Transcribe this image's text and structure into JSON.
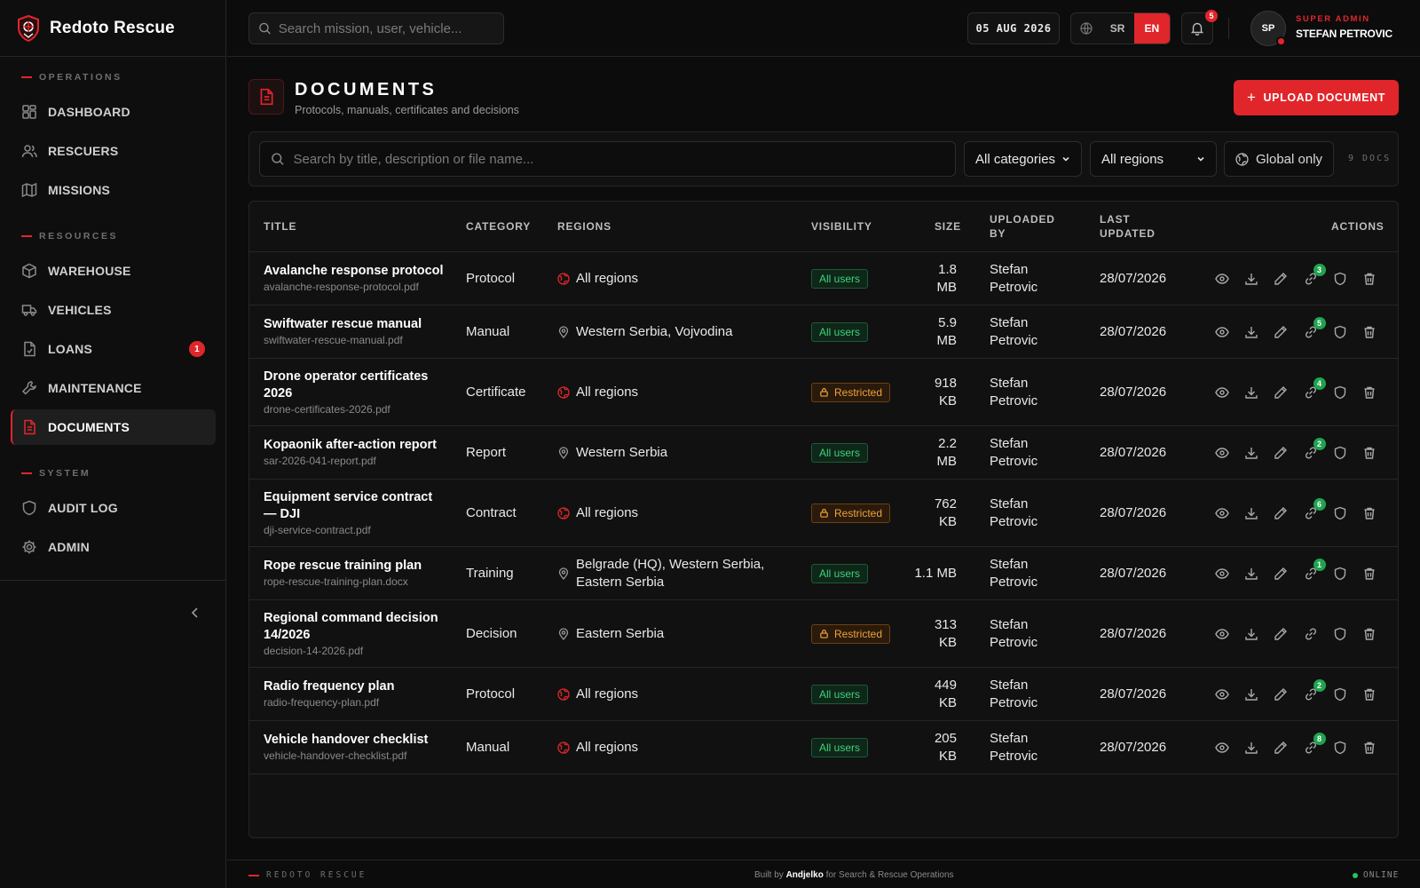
{
  "brand": {
    "name": "Redoto Rescue"
  },
  "sidebar": {
    "sections": [
      {
        "label": "OPERATIONS"
      },
      {
        "label": "RESOURCES"
      },
      {
        "label": "SYSTEM"
      }
    ],
    "items": [
      {
        "label": "DASHBOARD",
        "icon": "dashboard-icon"
      },
      {
        "label": "RESCUERS",
        "icon": "users-icon"
      },
      {
        "label": "MISSIONS",
        "icon": "map-icon"
      },
      {
        "label": "WAREHOUSE",
        "icon": "box-icon"
      },
      {
        "label": "VEHICLES",
        "icon": "truck-icon"
      },
      {
        "label": "LOANS",
        "icon": "file-icon",
        "badge": "1"
      },
      {
        "label": "MAINTENANCE",
        "icon": "wrench-icon"
      },
      {
        "label": "DOCUMENTS",
        "icon": "document-icon",
        "active": true
      },
      {
        "label": "AUDIT LOG",
        "icon": "shield-icon"
      },
      {
        "label": "ADMIN",
        "icon": "gear-icon"
      }
    ]
  },
  "topbar": {
    "search_placeholder": "Search mission, user, vehicle...",
    "date": "05 AUG 2026",
    "lang_sr": "SR",
    "lang_en": "EN",
    "notifications_count": "5",
    "avatar_initials": "SP",
    "user_role": "SUPER ADMIN",
    "user_name": "STEFAN PETROVIC"
  },
  "page": {
    "title": "DOCUMENTS",
    "subtitle": "Protocols, manuals, certificates and decisions",
    "upload_label": "UPLOAD DOCUMENT"
  },
  "filters": {
    "search_placeholder": "Search by title, description or file name...",
    "category": "All categories",
    "region": "All regions",
    "global_only": "Global only",
    "count": "9 DOCS"
  },
  "table": {
    "headers": {
      "title": "TITLE",
      "category": "CATEGORY",
      "regions": "REGIONS",
      "visibility": "VISIBILITY",
      "size": "SIZE",
      "uploaded_by_1": "UPLOADED",
      "uploaded_by_2": "BY",
      "last_updated_1": "LAST",
      "last_updated_2": "UPDATED",
      "actions": "ACTIONS"
    },
    "rows": [
      {
        "title": "Avalanche response protocol",
        "file": "avalanche-response-protocol.pdf",
        "category": "Protocol",
        "regions": "All regions",
        "global": true,
        "visibility": "All users",
        "size": "1.8 MB",
        "uploaded_by": "Stefan Petrovic",
        "updated": "28/07/2026",
        "links": "3"
      },
      {
        "title": "Swiftwater rescue manual",
        "file": "swiftwater-rescue-manual.pdf",
        "category": "Manual",
        "regions": "Western Serbia, Vojvodina",
        "global": false,
        "visibility": "All users",
        "size": "5.9 MB",
        "uploaded_by": "Stefan Petrovic",
        "updated": "28/07/2026",
        "links": "5"
      },
      {
        "title": "Drone operator certificates 2026",
        "file": "drone-certificates-2026.pdf",
        "category": "Certificate",
        "regions": "All regions",
        "global": true,
        "visibility": "Restricted",
        "size": "918 KB",
        "uploaded_by": "Stefan Petrovic",
        "updated": "28/07/2026",
        "links": "4"
      },
      {
        "title": "Kopaonik after-action report",
        "file": "sar-2026-041-report.pdf",
        "category": "Report",
        "regions": "Western Serbia",
        "global": false,
        "visibility": "All users",
        "size": "2.2 MB",
        "uploaded_by": "Stefan Petrovic",
        "updated": "28/07/2026",
        "links": "2"
      },
      {
        "title": "Equipment service contract — DJI",
        "file": "dji-service-contract.pdf",
        "category": "Contract",
        "regions": "All regions",
        "global": true,
        "visibility": "Restricted",
        "size": "762 KB",
        "uploaded_by": "Stefan Petrovic",
        "updated": "28/07/2026",
        "links": "6"
      },
      {
        "title": "Rope rescue training plan",
        "file": "rope-rescue-training-plan.docx",
        "category": "Training",
        "regions": "Belgrade (HQ), Western Serbia, Eastern Serbia",
        "global": false,
        "visibility": "All users",
        "size": "1.1 MB",
        "uploaded_by": "Stefan Petrovic",
        "updated": "28/07/2026",
        "links": "1"
      },
      {
        "title": "Regional command decision 14/2026",
        "file": "decision-14-2026.pdf",
        "category": "Decision",
        "regions": "Eastern Serbia",
        "global": false,
        "visibility": "Restricted",
        "size": "313 KB",
        "uploaded_by": "Stefan Petrovic",
        "updated": "28/07/2026",
        "links": ""
      },
      {
        "title": "Radio frequency plan",
        "file": "radio-frequency-plan.pdf",
        "category": "Protocol",
        "regions": "All regions",
        "global": true,
        "visibility": "All users",
        "size": "449 KB",
        "uploaded_by": "Stefan Petrovic",
        "updated": "28/07/2026",
        "links": "2"
      },
      {
        "title": "Vehicle handover checklist",
        "file": "vehicle-handover-checklist.pdf",
        "category": "Manual",
        "regions": "All regions",
        "global": true,
        "visibility": "All users",
        "size": "205 KB",
        "uploaded_by": "Stefan Petrovic",
        "updated": "28/07/2026",
        "links": "8"
      }
    ]
  },
  "footer": {
    "left": "REDOTO RESCUE",
    "built_by_prefix": "Built by",
    "built_by_name": "Andjelko",
    "built_by_suffix": "for Search & Rescue Operations",
    "status": "ONLINE"
  },
  "colors": {
    "accent": "#e0262b",
    "success": "#3fd27a",
    "warning": "#f0a23a"
  }
}
